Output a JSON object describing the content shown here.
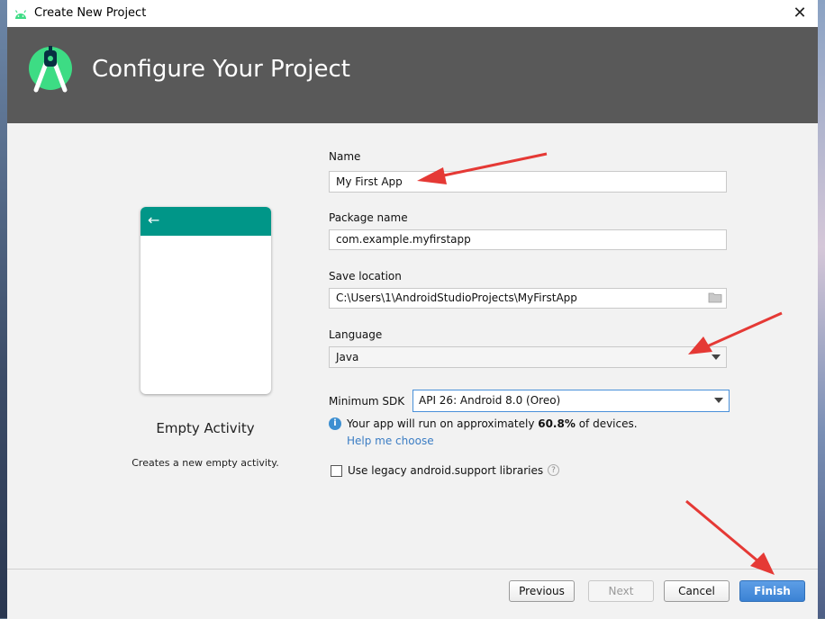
{
  "window": {
    "title": "Create New Project",
    "close_glyph": "✕"
  },
  "header": {
    "title": "Configure Your Project",
    "logo_icon": "android-studio-logo"
  },
  "template": {
    "back_glyph": "←",
    "name": "Empty Activity",
    "description": "Creates a new empty activity.",
    "bar_color": "#009688"
  },
  "form": {
    "name_label": "Name",
    "name_value": "My First App",
    "package_label": "Package name",
    "package_value": "com.example.myfirstapp",
    "save_label": "Save location",
    "save_value": "C:\\Users\\1\\AndroidStudioProjects\\MyFirstApp",
    "language_label": "Language",
    "language_value": "Java",
    "min_sdk_label": "Minimum SDK",
    "min_sdk_value": "API 26: Android 8.0 (Oreo)",
    "info_prefix": "Your app will run on approximately ",
    "info_percent": "60.8%",
    "info_suffix": " of devices.",
    "help_link": "Help me choose",
    "legacy_label": "Use legacy android.support libraries",
    "legacy_checked": false
  },
  "footer": {
    "previous": "Previous",
    "next": "Next",
    "cancel": "Cancel",
    "finish": "Finish"
  },
  "colors": {
    "header_bg": "#595959",
    "accent": "#3b82d4",
    "annotation_arrow": "#e53935"
  }
}
